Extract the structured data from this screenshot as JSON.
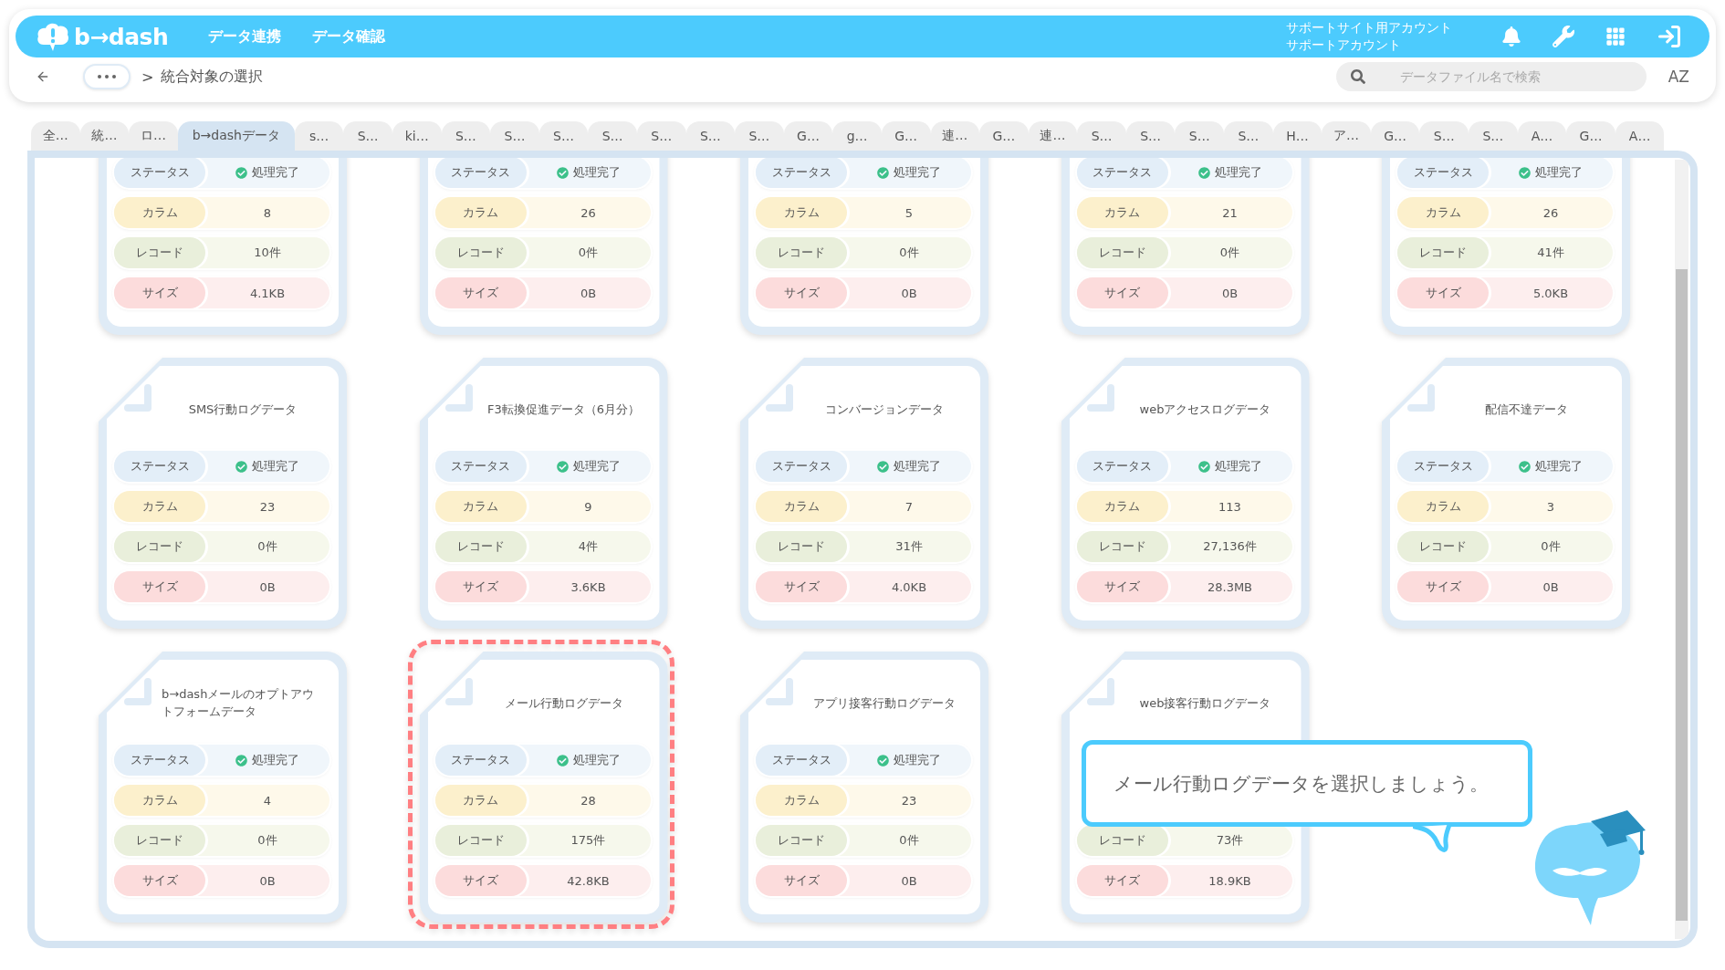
{
  "header": {
    "logo": "b→dash",
    "nav": [
      {
        "label": "データ連携"
      },
      {
        "label": "データ確認"
      }
    ],
    "account": [
      "サポートサイト用アカウント",
      "サポートアカウント"
    ]
  },
  "breadcrumb": {
    "separator": ">",
    "current": "統合対象の選択"
  },
  "search": {
    "placeholder": "データファイル名で検索"
  },
  "sort_button": "AZ",
  "tabs": [
    {
      "label": "全…",
      "selected": false
    },
    {
      "label": "統…",
      "selected": false
    },
    {
      "label": "ロ…",
      "selected": false
    },
    {
      "label": "b→dashデータ",
      "selected": true
    },
    {
      "label": "s…",
      "selected": false
    },
    {
      "label": "S…",
      "selected": false
    },
    {
      "label": "ki…",
      "selected": false
    },
    {
      "label": "S…",
      "selected": false
    },
    {
      "label": "S…",
      "selected": false
    },
    {
      "label": "S…",
      "selected": false
    },
    {
      "label": "S…",
      "selected": false
    },
    {
      "label": "S…",
      "selected": false
    },
    {
      "label": "S…",
      "selected": false
    },
    {
      "label": "S…",
      "selected": false
    },
    {
      "label": "G…",
      "selected": false
    },
    {
      "label": "g…",
      "selected": false
    },
    {
      "label": "G…",
      "selected": false
    },
    {
      "label": "連…",
      "selected": false
    },
    {
      "label": "G…",
      "selected": false
    },
    {
      "label": "連…",
      "selected": false
    },
    {
      "label": "S…",
      "selected": false
    },
    {
      "label": "S…",
      "selected": false
    },
    {
      "label": "S…",
      "selected": false
    },
    {
      "label": "S…",
      "selected": false
    },
    {
      "label": "H…",
      "selected": false
    },
    {
      "label": "ア…",
      "selected": false
    },
    {
      "label": "G…",
      "selected": false
    },
    {
      "label": "S…",
      "selected": false
    },
    {
      "label": "S…",
      "selected": false
    },
    {
      "label": "A…",
      "selected": false
    },
    {
      "label": "G…",
      "selected": false
    },
    {
      "label": "A…",
      "selected": false
    }
  ],
  "cards": [
    {
      "highlighted": false,
      "stats": [
        {
          "kind": "status",
          "label": "ステータス",
          "value": "処理完了"
        },
        {
          "kind": "column",
          "label": "カラム",
          "value": "8"
        },
        {
          "kind": "record",
          "label": "レコード",
          "value": "10件"
        },
        {
          "kind": "size",
          "label": "サイズ",
          "value": "4.1KB"
        }
      ]
    },
    {
      "highlighted": false,
      "stats": [
        {
          "kind": "status",
          "label": "ステータス",
          "value": "処理完了"
        },
        {
          "kind": "column",
          "label": "カラム",
          "value": "26"
        },
        {
          "kind": "record",
          "label": "レコード",
          "value": "0件"
        },
        {
          "kind": "size",
          "label": "サイズ",
          "value": "0B"
        }
      ]
    },
    {
      "highlighted": false,
      "stats": [
        {
          "kind": "status",
          "label": "ステータス",
          "value": "処理完了"
        },
        {
          "kind": "column",
          "label": "カラム",
          "value": "5"
        },
        {
          "kind": "record",
          "label": "レコード",
          "value": "0件"
        },
        {
          "kind": "size",
          "label": "サイズ",
          "value": "0B"
        }
      ]
    },
    {
      "highlighted": false,
      "stats": [
        {
          "kind": "status",
          "label": "ステータス",
          "value": "処理完了"
        },
        {
          "kind": "column",
          "label": "カラム",
          "value": "21"
        },
        {
          "kind": "record",
          "label": "レコード",
          "value": "0件"
        },
        {
          "kind": "size",
          "label": "サイズ",
          "value": "0B"
        }
      ]
    },
    {
      "highlighted": false,
      "stats": [
        {
          "kind": "status",
          "label": "ステータス",
          "value": "処理完了"
        },
        {
          "kind": "column",
          "label": "カラム",
          "value": "26"
        },
        {
          "kind": "record",
          "label": "レコード",
          "value": "41件"
        },
        {
          "kind": "size",
          "label": "サイズ",
          "value": "5.0KB"
        }
      ]
    },
    {
      "title": "SMS行動ログデータ",
      "highlighted": false,
      "stats": [
        {
          "kind": "status",
          "label": "ステータス",
          "value": "処理完了"
        },
        {
          "kind": "column",
          "label": "カラム",
          "value": "23"
        },
        {
          "kind": "record",
          "label": "レコード",
          "value": "0件"
        },
        {
          "kind": "size",
          "label": "サイズ",
          "value": "0B"
        }
      ]
    },
    {
      "title": "F3転換促進データ（6月分）",
      "highlighted": false,
      "stats": [
        {
          "kind": "status",
          "label": "ステータス",
          "value": "処理完了"
        },
        {
          "kind": "column",
          "label": "カラム",
          "value": "9"
        },
        {
          "kind": "record",
          "label": "レコード",
          "value": "4件"
        },
        {
          "kind": "size",
          "label": "サイズ",
          "value": "3.6KB"
        }
      ]
    },
    {
      "title": "コンバージョンデータ",
      "highlighted": false,
      "stats": [
        {
          "kind": "status",
          "label": "ステータス",
          "value": "処理完了"
        },
        {
          "kind": "column",
          "label": "カラム",
          "value": "7"
        },
        {
          "kind": "record",
          "label": "レコード",
          "value": "31件"
        },
        {
          "kind": "size",
          "label": "サイズ",
          "value": "4.0KB"
        }
      ]
    },
    {
      "title": "webアクセスログデータ",
      "highlighted": false,
      "stats": [
        {
          "kind": "status",
          "label": "ステータス",
          "value": "処理完了"
        },
        {
          "kind": "column",
          "label": "カラム",
          "value": "113"
        },
        {
          "kind": "record",
          "label": "レコード",
          "value": "27,136件"
        },
        {
          "kind": "size",
          "label": "サイズ",
          "value": "28.3MB"
        }
      ]
    },
    {
      "title": "配信不達データ",
      "highlighted": false,
      "stats": [
        {
          "kind": "status",
          "label": "ステータス",
          "value": "処理完了"
        },
        {
          "kind": "column",
          "label": "カラム",
          "value": "3"
        },
        {
          "kind": "record",
          "label": "レコード",
          "value": "0件"
        },
        {
          "kind": "size",
          "label": "サイズ",
          "value": "0B"
        }
      ]
    },
    {
      "title": "b→dashメールのオプトアウトフォームデータ",
      "highlighted": false,
      "stats": [
        {
          "kind": "status",
          "label": "ステータス",
          "value": "処理完了"
        },
        {
          "kind": "column",
          "label": "カラム",
          "value": "4"
        },
        {
          "kind": "record",
          "label": "レコード",
          "value": "0件"
        },
        {
          "kind": "size",
          "label": "サイズ",
          "value": "0B"
        }
      ]
    },
    {
      "title": "メール行動ログデータ",
      "highlighted": true,
      "stats": [
        {
          "kind": "status",
          "label": "ステータス",
          "value": "処理完了"
        },
        {
          "kind": "column",
          "label": "カラム",
          "value": "28"
        },
        {
          "kind": "record",
          "label": "レコード",
          "value": "175件"
        },
        {
          "kind": "size",
          "label": "サイズ",
          "value": "42.8KB"
        }
      ]
    },
    {
      "title": "アプリ接客行動ログデータ",
      "highlighted": false,
      "stats": [
        {
          "kind": "status",
          "label": "ステータス",
          "value": "処理完了"
        },
        {
          "kind": "column",
          "label": "カラム",
          "value": "23"
        },
        {
          "kind": "record",
          "label": "レコード",
          "value": "0件"
        },
        {
          "kind": "size",
          "label": "サイズ",
          "value": "0B"
        }
      ]
    },
    {
      "title": "web接客行動ログデータ",
      "highlighted": false,
      "stats": [
        {
          "kind": "record",
          "label": "レコード",
          "value": "73件"
        },
        {
          "kind": "size",
          "label": "サイズ",
          "value": "18.9KB"
        }
      ]
    }
  ],
  "tooltip": "メール行動ログデータを選択しましょう。"
}
